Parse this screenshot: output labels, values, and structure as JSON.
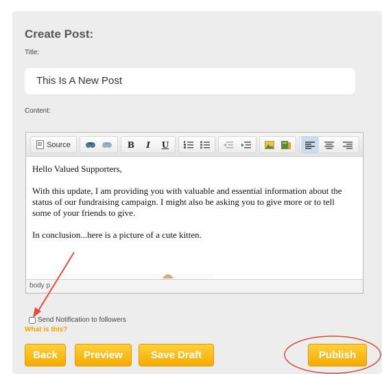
{
  "form": {
    "heading": "Create Post:",
    "title_label": "Title:",
    "title_value": "This Is A New Post",
    "content_label": "Content:"
  },
  "toolbar": {
    "source_label": "Source",
    "bold": "B",
    "italic": "I",
    "underline": "U",
    "icons": [
      "source-icon",
      "find-icon",
      "replace-icon",
      "bold-icon",
      "italic-icon",
      "underline-icon",
      "numbered-list-icon",
      "bulleted-list-icon",
      "outdent-icon",
      "indent-icon",
      "image-icon",
      "flash-icon",
      "align-left-icon",
      "align-center-icon",
      "align-right-icon"
    ]
  },
  "editor": {
    "paragraphs": [
      "Hello Valued Supporters,",
      "With this update, I am providing you with valuable and essential information about the status of our fundraising campaign.  I might also be asking you to give more or to tell some of your friends to give.",
      "In conclusion...here is a picture of a cute kitten."
    ],
    "status_path": "body  p"
  },
  "notification": {
    "checkbox_label": "Send Notification to followers",
    "checked": false,
    "help_link": "What is this?"
  },
  "buttons": {
    "back": "Back",
    "preview": "Preview",
    "save_draft": "Save Draft",
    "publish": "Publish"
  },
  "annotations": {
    "arrow_color": "#e34b3c",
    "circle_color": "#d8473a"
  },
  "colors": {
    "accent": "#f5aa00",
    "panel": "#ededed",
    "link": "#f5a400"
  }
}
